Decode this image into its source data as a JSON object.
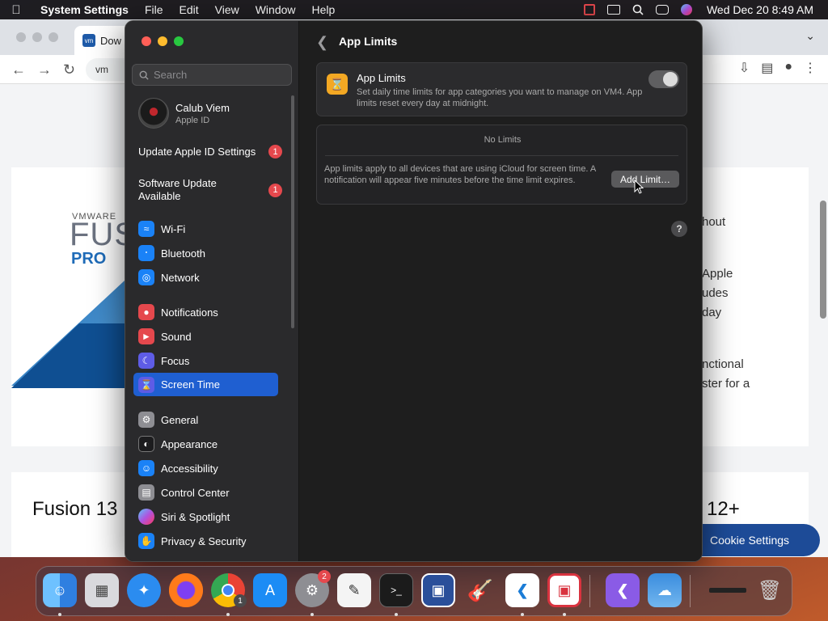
{
  "menubar": {
    "app_name": "System Settings",
    "menus": [
      "File",
      "Edit",
      "View",
      "Window",
      "Help"
    ],
    "clock": "Wed Dec 20  8:49 AM"
  },
  "browser": {
    "tab_title": "Dow",
    "url_fragment": "vm",
    "logo_small": "VMWARE",
    "logo_big": "FUS",
    "logo_pro": "PRO",
    "right_text": [
      "hout",
      "Apple",
      "udes",
      "day",
      "nctional",
      "ster for a"
    ],
    "heading_left": "Fusion 13",
    "heading_right": "12+",
    "cookie_button": "Cookie Settings"
  },
  "sidebar": {
    "search_placeholder": "Search",
    "account_name": "Calub Viem",
    "account_sub": "Apple ID",
    "updates": [
      {
        "label": "Update Apple ID Settings",
        "badge": "1"
      },
      {
        "label": "Software Update Available",
        "badge": "1"
      }
    ],
    "items": [
      {
        "label": "Wi-Fi",
        "icon": "wifi-icon",
        "color": "#1a82f7"
      },
      {
        "label": "Bluetooth",
        "icon": "bluetooth-icon",
        "color": "#1a82f7"
      },
      {
        "label": "Network",
        "icon": "globe-icon",
        "color": "#1a82f7"
      },
      {
        "label": "Notifications",
        "icon": "bell-icon",
        "color": "#e5484d"
      },
      {
        "label": "Sound",
        "icon": "speaker-icon",
        "color": "#e5484d"
      },
      {
        "label": "Focus",
        "icon": "moon-icon",
        "color": "#5e5ce6"
      },
      {
        "label": "Screen Time",
        "icon": "hourglass-icon",
        "color": "#5e5ce6"
      },
      {
        "label": "General",
        "icon": "gear-icon",
        "color": "#8e8e93"
      },
      {
        "label": "Appearance",
        "icon": "appearance-icon",
        "color": "#1c1c1e"
      },
      {
        "label": "Accessibility",
        "icon": "accessibility-icon",
        "color": "#1a82f7"
      },
      {
        "label": "Control Center",
        "icon": "control-center-icon",
        "color": "#8e8e93"
      },
      {
        "label": "Siri & Spotlight",
        "icon": "siri-icon",
        "color": "#b44bd1"
      },
      {
        "label": "Privacy & Security",
        "icon": "hand-icon",
        "color": "#1a82f7"
      }
    ],
    "selected": "Screen Time"
  },
  "main": {
    "title": "App Limits",
    "panel_heading": "App Limits",
    "panel_desc": "Set daily time limits for app categories you want to manage on VM4. App limits reset every day at midnight.",
    "toggle_on": false,
    "empty_state": "No Limits",
    "note": "App limits apply to all devices that are using iCloud for screen time. A notification will appear five minutes before the time limit expires.",
    "add_button": "Add Limit…",
    "help": "?"
  },
  "dock": {
    "apps": [
      "finder-icon",
      "launchpad-icon",
      "safari-icon",
      "firefox-icon",
      "chrome-icon",
      "app-store-icon",
      "system-settings-icon",
      "textedit-icon",
      "terminal-icon",
      "vmware-fusion-icon",
      "garageband-icon",
      "vscode-icon",
      "parallels-icon",
      "visual-studio-icon",
      "weather-icon",
      "minimized-window-icon",
      "trash-icon"
    ],
    "system_settings_badge": "2",
    "chrome_badge": "1"
  }
}
